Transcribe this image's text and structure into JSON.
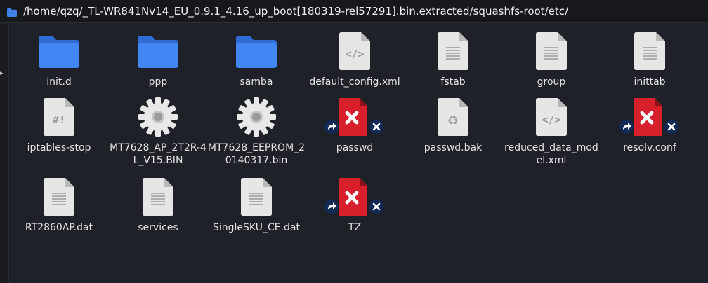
{
  "window": {
    "path": "/home/qzq/_TL-WR841Nv14_EU_0.9.1_4.16_up_boot[180319-rel57291].bin.extracted/squashfs-root/etc/"
  },
  "colors": {
    "folder": "#3f7fe6",
    "background": "#1e2127",
    "broken_link_red": "#d8202c",
    "badge_dark": "#102a55"
  },
  "files": [
    {
      "name": "init.d",
      "icon": "folder-icon"
    },
    {
      "name": "ppp",
      "icon": "folder-icon"
    },
    {
      "name": "samba",
      "icon": "folder-icon"
    },
    {
      "name": "default_config.xml",
      "icon": "code-file-icon"
    },
    {
      "name": "fstab",
      "icon": "text-file-icon"
    },
    {
      "name": "group",
      "icon": "text-file-icon"
    },
    {
      "name": "inittab",
      "icon": "text-file-icon"
    },
    {
      "name": "iptables-stop",
      "icon": "script-file-icon"
    },
    {
      "name": "MT7628_AP_2T2R-4L_V15.BIN",
      "icon": "gear-icon"
    },
    {
      "name": "MT7628_EEPROM_20140317.bin",
      "icon": "gear-icon"
    },
    {
      "name": "passwd",
      "icon": "broken-link-icon"
    },
    {
      "name": "passwd.bak",
      "icon": "recycle-file-icon"
    },
    {
      "name": "reduced_data_model.xml",
      "icon": "code-file-icon"
    },
    {
      "name": "resolv.conf",
      "icon": "broken-link-icon"
    },
    {
      "name": "RT2860AP.dat",
      "icon": "text-file-icon"
    },
    {
      "name": "services",
      "icon": "text-file-icon"
    },
    {
      "name": "SingleSKU_CE.dat",
      "icon": "text-file-icon"
    },
    {
      "name": "TZ",
      "icon": "broken-link-icon"
    }
  ]
}
